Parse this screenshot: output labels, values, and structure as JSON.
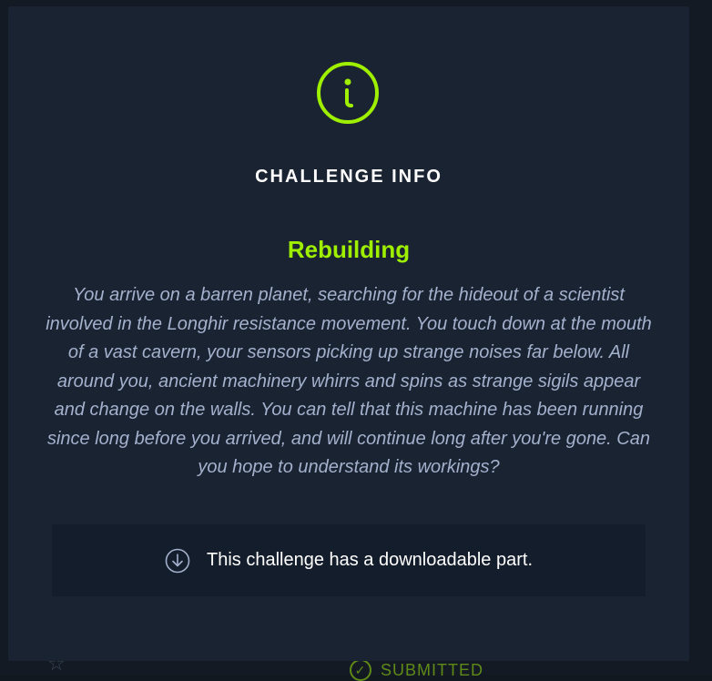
{
  "modal": {
    "title": "CHALLENGE INFO",
    "challenge_name": "Rebuilding",
    "description": "You arrive on a barren planet, searching for the hideout of a scientist involved in the Longhir resistance movement. You touch down at the mouth of a vast cavern, your sensors picking up strange noises far below. All around you, ancient machinery whirrs and spins as strange sigils appear and change on the walls. You can tell that this machine has been running since long before you arrived, and will continue long after you're gone. Can you hope to understand its workings?",
    "download_notice": "This challenge has a downloadable part."
  },
  "background": {
    "status_label": "SUBMITTED"
  },
  "icons": {
    "info": "info-circle-icon",
    "download": "download-circle-icon",
    "star": "star-icon",
    "check": "check-circle-icon"
  },
  "colors": {
    "accent": "#9fef00",
    "modal_bg": "#1a2332",
    "box_bg": "#141d2b",
    "text_muted": "#a4b1cd",
    "text_white": "#ffffff"
  }
}
